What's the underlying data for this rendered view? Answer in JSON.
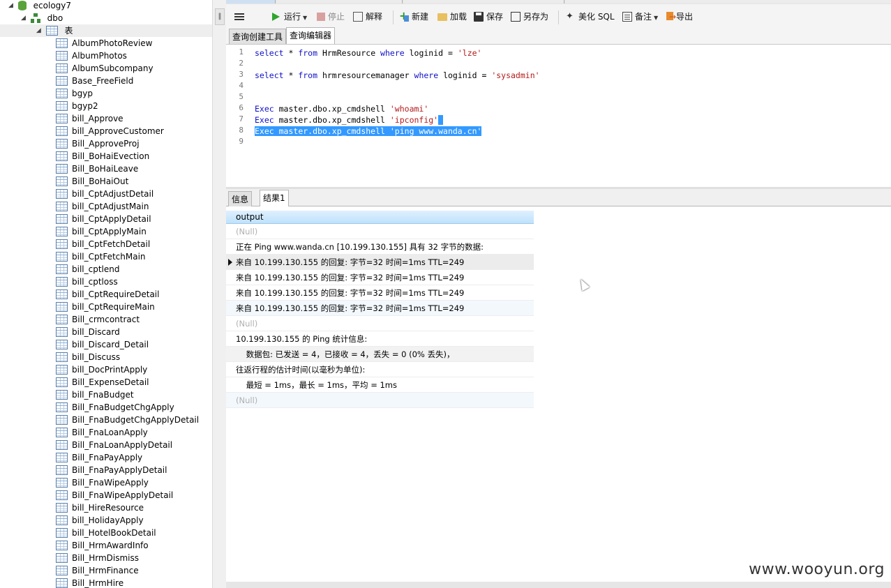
{
  "tree": {
    "db": "ecology7",
    "schema": "dbo",
    "folder": "表",
    "tables": [
      "AlbumPhotoReview",
      "AlbumPhotos",
      "AlbumSubcompany",
      "Base_FreeField",
      "bgyp",
      "bgyp2",
      "bill_Approve",
      "bill_ApproveCustomer",
      "Bill_ApproveProj",
      "Bill_BoHaiEvection",
      "Bill_BoHaiLeave",
      "Bill_BoHaiOut",
      "bill_CptAdjustDetail",
      "bill_CptAdjustMain",
      "bill_CptApplyDetail",
      "bill_CptApplyMain",
      "bill_CptFetchDetail",
      "bill_CptFetchMain",
      "bill_cptlend",
      "bill_cptloss",
      "bill_CptRequireDetail",
      "bill_CptRequireMain",
      "Bill_crmcontract",
      "bill_Discard",
      "bill_Discard_Detail",
      "bill_Discuss",
      "bill_DocPrintApply",
      "Bill_ExpenseDetail",
      "bill_FnaBudget",
      "Bill_FnaBudgetChgApply",
      "Bill_FnaBudgetChgApplyDetail",
      "Bill_FnaLoanApply",
      "Bill_FnaLoanApplyDetail",
      "Bill_FnaPayApply",
      "Bill_FnaPayApplyDetail",
      "Bill_FnaWipeApply",
      "Bill_FnaWipeApplyDetail",
      "bill_HireResource",
      "bill_HolidayApply",
      "bill_HotelBookDetail",
      "Bill_HrmAwardInfo",
      "Bill_HrmDismiss",
      "Bill_HrmFinance",
      "Bill_HrmHire"
    ]
  },
  "toolbar": {
    "run": "运行",
    "stop": "停止",
    "explain": "解释",
    "new": "新建",
    "load": "加载",
    "save": "保存",
    "saveas": "另存为",
    "beautify": "美化 SQL",
    "note": "备注",
    "export": "导出"
  },
  "editor_tabs": [
    "查询创建工具",
    "查询编辑器"
  ],
  "editor": {
    "line_numbers": [
      "1",
      "2",
      "3",
      "4",
      "5",
      "6",
      "7",
      "8",
      "9"
    ],
    "l1": {
      "kw1": "select",
      "t1": " * ",
      "kw2": "from",
      "t2": " HrmResource ",
      "kw3": "where",
      "t3": " loginid = ",
      "s": "'lze'"
    },
    "l3": {
      "kw1": "select",
      "t1": " * ",
      "kw2": "from",
      "t2": " hrmresourcemanager ",
      "kw3": "where",
      "t3": " loginid = ",
      "s": "'sysadmin'"
    },
    "l6": {
      "kw": "Exec",
      "t": " master.dbo.xp_cmdshell ",
      "s": "'whoami'"
    },
    "l7": {
      "kw": "Exec",
      "t": " master.dbo.xp_cmdshell ",
      "s": "'ipconfig'"
    },
    "l8": {
      "kw": "Exec",
      "t": " master.dbo.xp_cmdshell ",
      "s": "'ping www.wanda.cn'"
    }
  },
  "result_tabs": [
    "信息",
    "结果1"
  ],
  "grid": {
    "column": "output",
    "rows": [
      "(Null)",
      "正在 Ping www.wanda.cn [10.199.130.155] 具有 32 字节的数据:",
      "来自 10.199.130.155 的回复: 字节=32 时间=1ms TTL=249",
      "来自 10.199.130.155 的回复: 字节=32 时间=1ms TTL=249",
      "来自 10.199.130.155 的回复: 字节=32 时间=1ms TTL=249",
      "来自 10.199.130.155 的回复: 字节=32 时间=1ms TTL=249",
      "(Null)",
      "10.199.130.155 的 Ping 统计信息:",
      "    数据包: 已发送 = 4，已接收 = 4，丢失 = 0 (0% 丢失)，",
      "往返行程的估计时间(以毫秒为单位):",
      "    最短 = 1ms，最长 = 1ms，平均 = 1ms",
      "(Null)"
    ]
  },
  "watermark": "www.wooyun.org",
  "colors": {
    "selection": "#3399ff",
    "keyword": "#1010c8",
    "string": "#b21a1a",
    "run_icon": "#2fa52f"
  }
}
